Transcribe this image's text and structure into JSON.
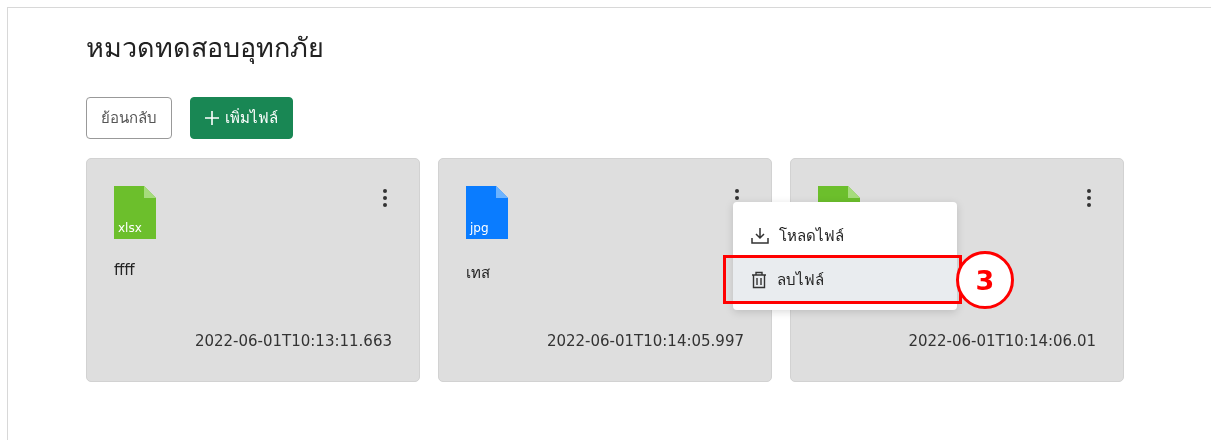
{
  "title": "หมวดทดสอบอุทกภัย",
  "buttons": [
    {
      "kind": "back",
      "label": "ย้อนกลับ"
    },
    {
      "kind": "add",
      "label": "เพิ่มไฟล์"
    }
  ],
  "files": [
    {
      "kind": "xlsx",
      "ext_label": "xlsx",
      "name": "ffff",
      "date": "2022-06-01T10:13:11.663",
      "menu_open": false
    },
    {
      "kind": "jpg",
      "ext_label": "jpg",
      "name": "เทส",
      "date": "2022-06-01T10:14:05.997",
      "menu_open": true
    },
    {
      "kind": "xlsx",
      "date": "2022-06-01T10:14:06.01",
      "menu_open": false
    }
  ],
  "menu": {
    "items": [
      {
        "kind": "download",
        "label": "โหลดไฟล์",
        "selected": false
      },
      {
        "kind": "delete",
        "label": "ลบไฟล์",
        "selected": true
      }
    ]
  },
  "callout": {
    "number": "3"
  }
}
